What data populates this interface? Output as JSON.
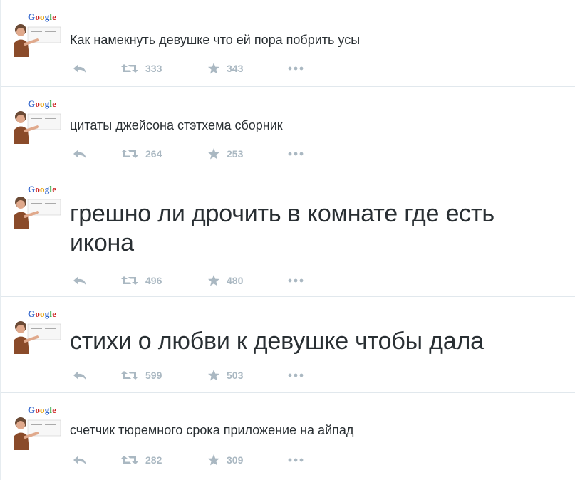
{
  "colors": {
    "action": "#aab8c2",
    "text": "#292f33",
    "divider": "#e1e8ed"
  },
  "avatar_logo": {
    "letters": [
      "G",
      "o",
      "o",
      "g",
      "l",
      "e"
    ],
    "colors": [
      "#3366cc",
      "#cc2222",
      "#e8a000",
      "#3366cc",
      "#33aa44",
      "#cc2222"
    ]
  },
  "tweets": [
    {
      "text": "Как намекнуть девушке что ей пора побрить усы",
      "retweets": "333",
      "favorites": "343"
    },
    {
      "text": "цитаты джейсона стэтхема сборник",
      "retweets": "264",
      "favorites": "253"
    },
    {
      "text": "грешно ли дрочить в комнате где есть икона",
      "retweets": "496",
      "favorites": "480"
    },
    {
      "text": "стихи о любви к девушке чтобы дала",
      "retweets": "599",
      "favorites": "503"
    },
    {
      "text": "счетчик тюремного срока приложение на айпад",
      "retweets": "282",
      "favorites": "309"
    }
  ],
  "icons": {
    "reply": "reply-icon",
    "retweet": "retweet-icon",
    "favorite": "star-icon",
    "more": "more-dots-icon",
    "avatar": "google-man-avatar"
  }
}
